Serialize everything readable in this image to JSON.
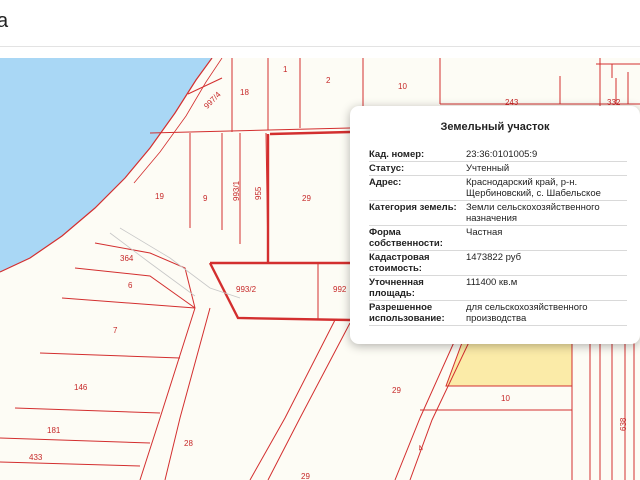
{
  "header": {
    "title": "а"
  },
  "map": {
    "colors": {
      "water": "#a9d7f5",
      "land": "#fdfcf5",
      "boundary": "#d32f2f",
      "selected": "#fbeba8"
    },
    "labels": [
      "1",
      "2",
      "10",
      "18",
      "243",
      "332",
      "997/4",
      "19",
      "9",
      "993/1",
      "955",
      "29",
      "364",
      "6",
      "993/2",
      "992",
      "7",
      "146",
      "181",
      "433",
      "28",
      "29",
      "10",
      "4",
      "638",
      "29"
    ]
  },
  "popup": {
    "title": "Земельный участок",
    "rows": [
      {
        "label": "Кад. номер:",
        "value": "23:36:0101005:9"
      },
      {
        "label": "Статус:",
        "value": "Учтенный"
      },
      {
        "label": "Адрес:",
        "value": "Краснодарский край, р-н. Щербиновский, с. Шабельское"
      },
      {
        "label": "Категория земель:",
        "value": "Земли сельскохозяйственного назначения"
      },
      {
        "label": "Форма собственности:",
        "value": "Частная"
      },
      {
        "label": "Кадастровая стоимость:",
        "value": "1473822 руб"
      },
      {
        "label": "Уточненная площадь:",
        "value": "111400 кв.м"
      },
      {
        "label": "Разрешенное использование:",
        "value": "для сельскохозяйственного производства"
      }
    ]
  }
}
